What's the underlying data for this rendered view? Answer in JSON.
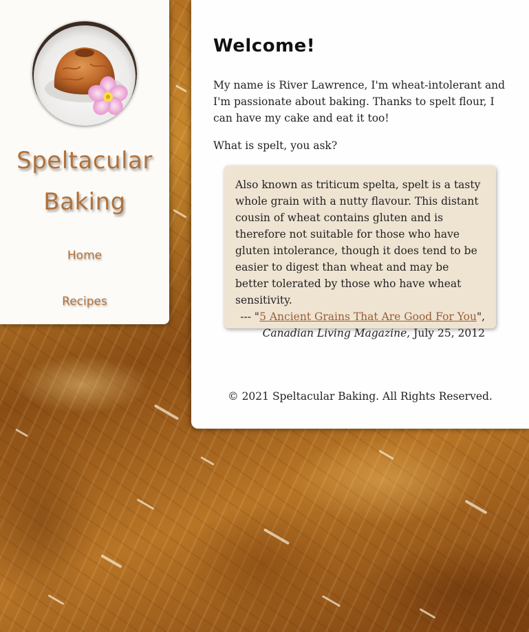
{
  "site": {
    "title_line1": "Speltacular",
    "title_line2": "Baking"
  },
  "nav": {
    "items": [
      {
        "label": "Home"
      },
      {
        "label": "Recipes"
      }
    ]
  },
  "main": {
    "heading": "Welcome!",
    "intro": "My name is River Lawrence, I'm wheat-intolerant and I'm passionate about baking. Thanks to spelt flour, I can have my cake and eat it too!",
    "question": "What is spelt, you ask?",
    "quote": {
      "text": "Also known as triticum spelta, spelt is a tasty whole grain with a nutty flavour. This distant cousin of wheat contains gluten and is therefore not suitable for those who have gluten intolerance, though it does tend to be easier to digest than wheat and may be better tolerated by those who have wheat sensitivity.",
      "cite_prefix": "--- \"",
      "link_text": "5 Ancient Grains That Are Good For You",
      "cite_after_link": "\",",
      "publication": "Canadian Living Magazine",
      "date": ", July 25, 2012"
    },
    "footer": "© 2021 Speltacular Baking. All Rights Reserved."
  },
  "colors": {
    "accent": "#b2713a",
    "link": "#9b5c36",
    "quote_bg": "#efe4d2",
    "panel_bg": "#fcfbf7"
  },
  "icons": {
    "logo": "bundt-cake-with-flower-logo"
  }
}
